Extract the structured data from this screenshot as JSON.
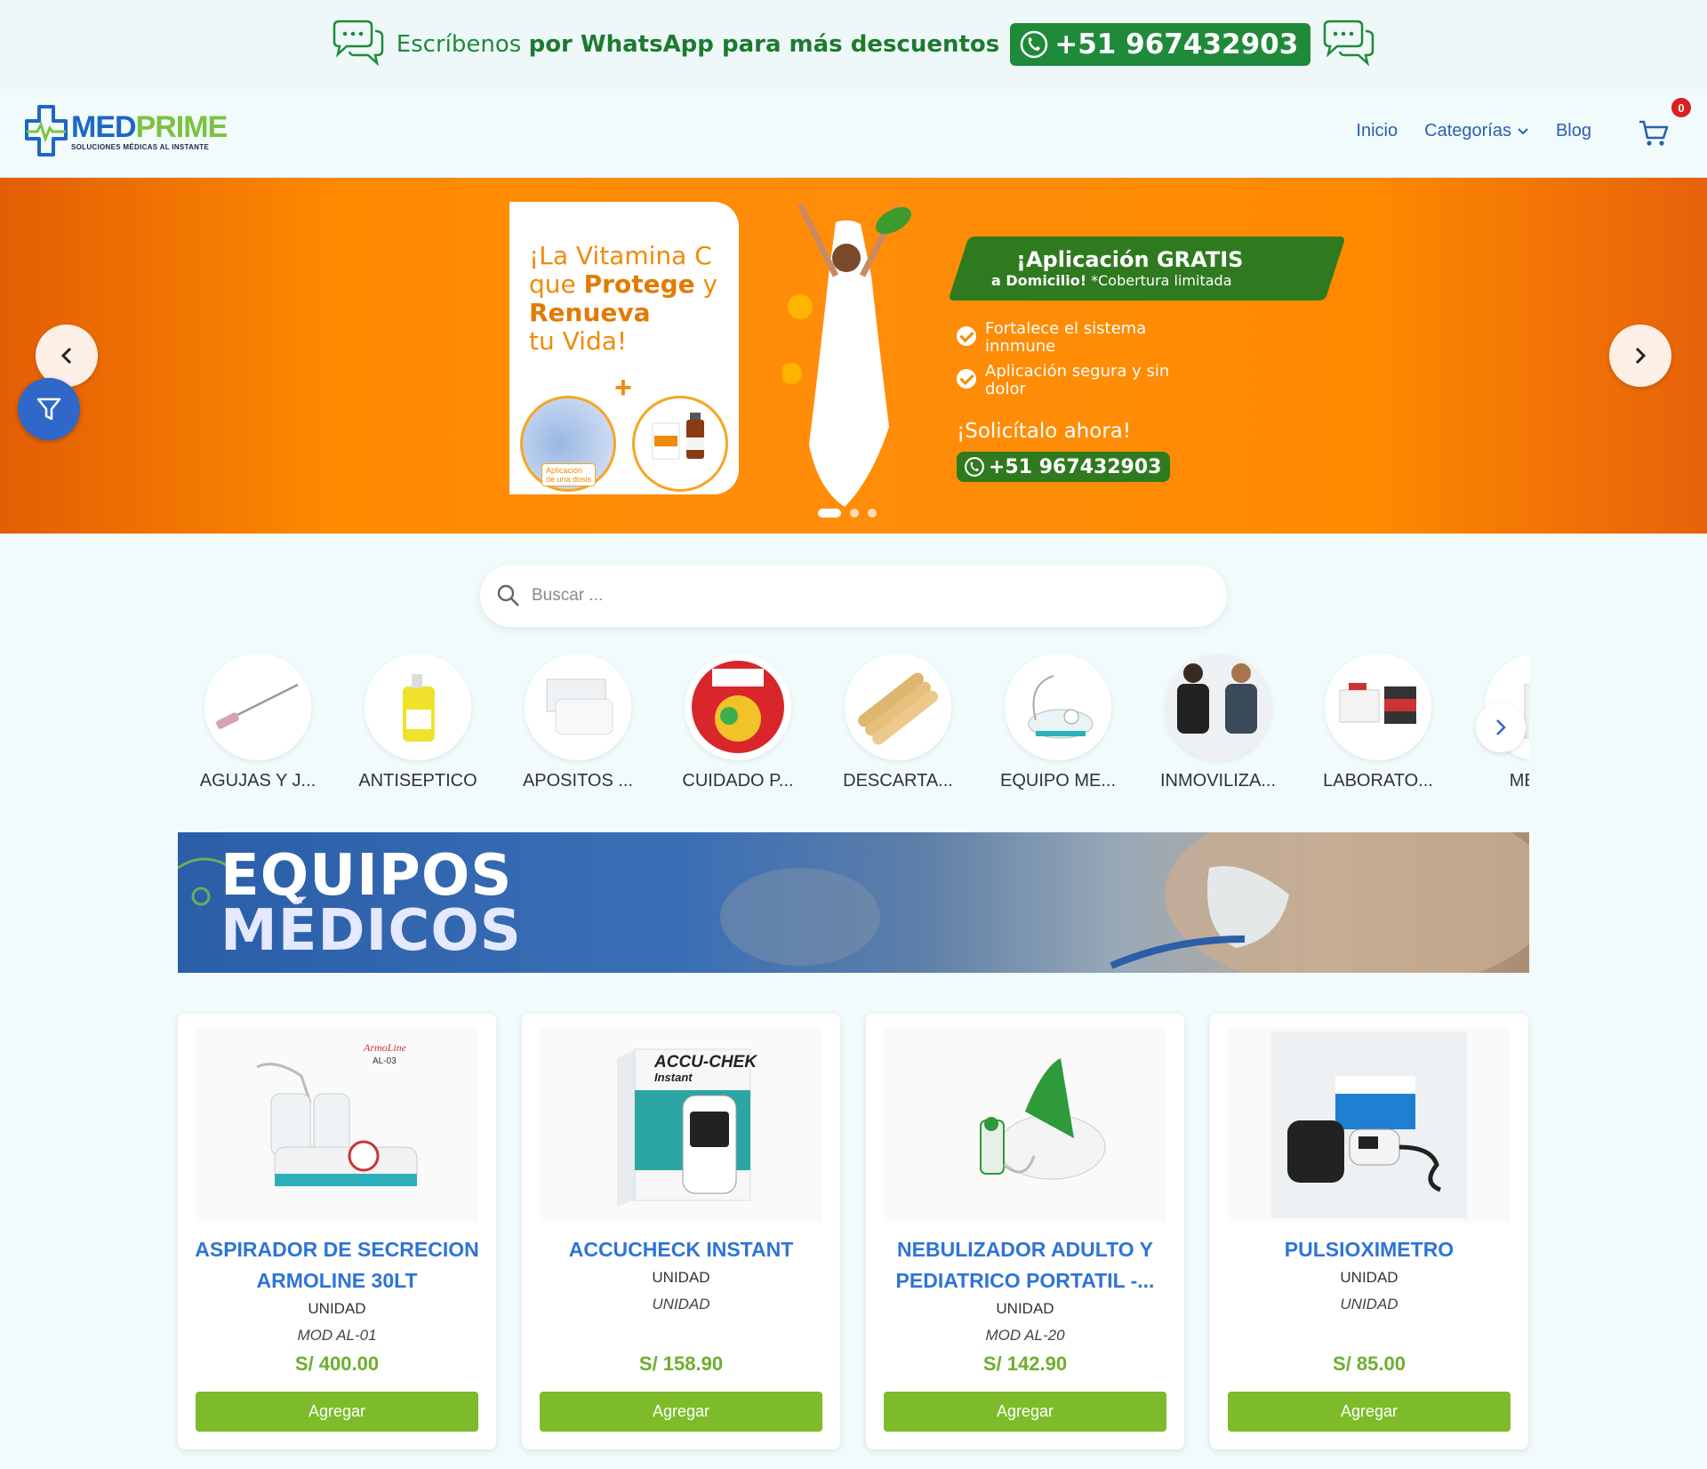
{
  "promo": {
    "text_prefix": "Escríbenos ",
    "text_bold": "por WhatsApp para más descuentos",
    "phone": "+51 967432903"
  },
  "header": {
    "logo_med": "MED",
    "logo_prime": "PRIME",
    "logo_tagline": "SOLUCIONES MÉDICAS AL INSTANTE",
    "nav": [
      {
        "label": "Inicio"
      },
      {
        "label": "Categorías"
      },
      {
        "label": "Blog"
      }
    ],
    "cart_count": "0"
  },
  "hero": {
    "card_l1": "¡La Vitamina C",
    "card_l2a": "que ",
    "card_l2b": "Protege",
    "card_l2c": " y",
    "card_l3": "Renueva",
    "card_l4": "tu Vida!",
    "card_badge_1": "Aplicación",
    "card_badge_1b": "de una dosis",
    "pill_title": "¡Aplicación GRATIS",
    "pill_sub_bold": "a Domicilio!",
    "pill_sub": " *Cobertura limitada",
    "feature_1": "Fortalece el sistema innmune",
    "feature_2": "Aplicación segura y sin dolor",
    "cta": "¡Solicítalo ahora!",
    "phone": "+51 967432903",
    "slides": 3,
    "active_slide": 1
  },
  "search": {
    "placeholder": "Buscar ..."
  },
  "categories": [
    {
      "label": "AGUJAS Y J..."
    },
    {
      "label": "ANTISEPTICO"
    },
    {
      "label": "APOSITOS ..."
    },
    {
      "label": "CUIDADO P..."
    },
    {
      "label": "DESCARTA..."
    },
    {
      "label": "EQUIPO ME..."
    },
    {
      "label": "INMOVILIZA..."
    },
    {
      "label": "LABORATO..."
    },
    {
      "label": "MEDIC"
    }
  ],
  "section": {
    "line1": "EQUIPOS",
    "line2": "MÉDICOS"
  },
  "products": [
    {
      "name_l1": "ASPIRADOR DE SECRECION",
      "name_l2": "ARMOLINE 30LT",
      "unit": "UNIDAD",
      "model": "MOD AL-01",
      "price": "S/ 400.00",
      "button": "Agregar",
      "brand": "ArmoLine",
      "code": "AL-03"
    },
    {
      "name_l1": "ACCUCHECK INSTANT",
      "name_l2": "",
      "unit": "UNIDAD",
      "model": "UNIDAD",
      "price": "S/ 158.90",
      "button": "Agregar",
      "brand": "ACCU-CHEK",
      "code": "Instant"
    },
    {
      "name_l1": "NEBULIZADOR ADULTO Y",
      "name_l2": "PEDIATRICO PORTATIL -...",
      "unit": "UNIDAD",
      "model": "MOD AL-20",
      "price": "S/ 142.90",
      "button": "Agregar"
    },
    {
      "name_l1": "PULSIOXIMETRO",
      "name_l2": "",
      "unit": "UNIDAD",
      "model": "UNIDAD",
      "price": "S/ 85.00",
      "button": "Agregar"
    }
  ],
  "colors": {
    "brand_blue": "#1d67c6",
    "brand_green": "#7cc242",
    "whatsapp_green": "#1f8a3a",
    "banner_orange": "#ff8a00",
    "link_blue": "#2f74d6",
    "price_green": "#6fae2c",
    "button_green": "#7dbb2a"
  }
}
